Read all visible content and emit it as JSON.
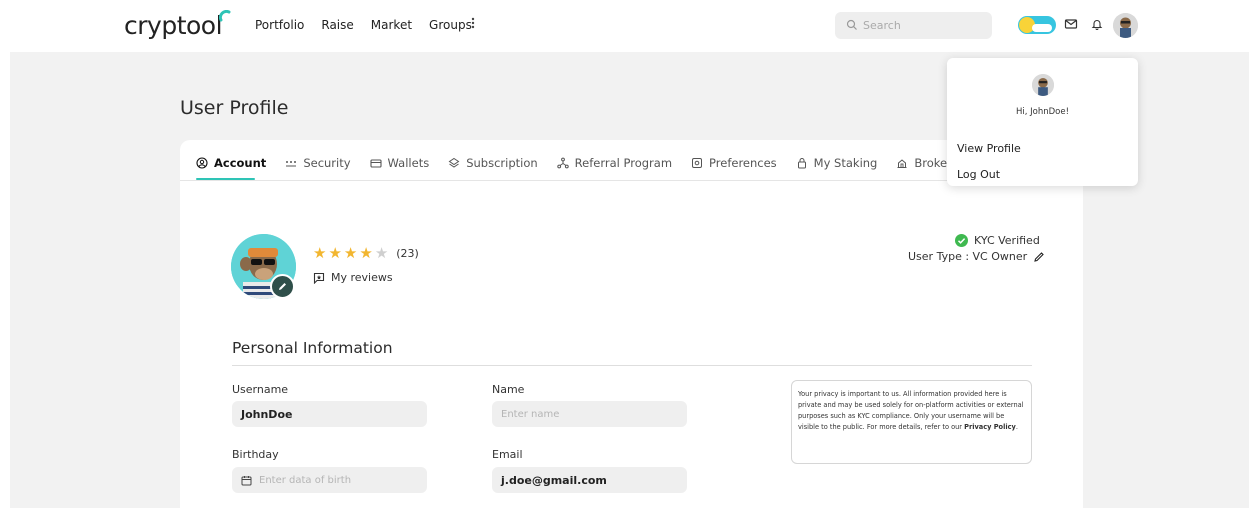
{
  "brand": {
    "name": "cryptool",
    "accent": "#2ec4b6"
  },
  "nav": {
    "links": [
      "Portfolio",
      "Raise",
      "Market",
      "Groups"
    ],
    "more_icon": "kebab-icon",
    "search_placeholder": "Search"
  },
  "header_icons": [
    "theme-toggle",
    "mail-icon",
    "bell-icon",
    "avatar"
  ],
  "page": {
    "title": "User Profile"
  },
  "tabs": [
    {
      "label": "Account",
      "icon": "user-circle-icon",
      "active": true
    },
    {
      "label": "Security",
      "icon": "password-icon"
    },
    {
      "label": "Wallets",
      "icon": "wallet-icon"
    },
    {
      "label": "Subscription",
      "icon": "layers-icon"
    },
    {
      "label": "Referral Program",
      "icon": "network-icon"
    },
    {
      "label": "Preferences",
      "icon": "settings-square-icon"
    },
    {
      "label": "My Staking",
      "icon": "lock-icon"
    },
    {
      "label": "Broker Settings",
      "icon": "broker-icon"
    }
  ],
  "profile": {
    "rating": 4,
    "rating_max": 5,
    "rating_count": "(23)",
    "reviews_label": "My reviews",
    "kyc_label": "KYC Verified",
    "user_type": "User Type : VC Owner"
  },
  "personal_info": {
    "title": "Personal Information",
    "username_label": "Username",
    "username_value": "JohnDoe",
    "name_label": "Name",
    "name_placeholder": "Enter name",
    "birthday_label": "Birthday",
    "birthday_placeholder": "Enter data of birth",
    "email_label": "Email",
    "email_value": "j.doe@gmail.com",
    "privacy_text": "Your privacy is important to us. All information provided here is private and may be used solely for on-platform activities or external purposes such as KYC compliance. Only your username will be visible to the public. For more details, refer to our",
    "privacy_link": "Privacy Policy",
    "privacy_end": "."
  },
  "dropdown": {
    "greeting": "Hi, JohnDoe!",
    "items": [
      "View Profile",
      "Log Out"
    ]
  }
}
